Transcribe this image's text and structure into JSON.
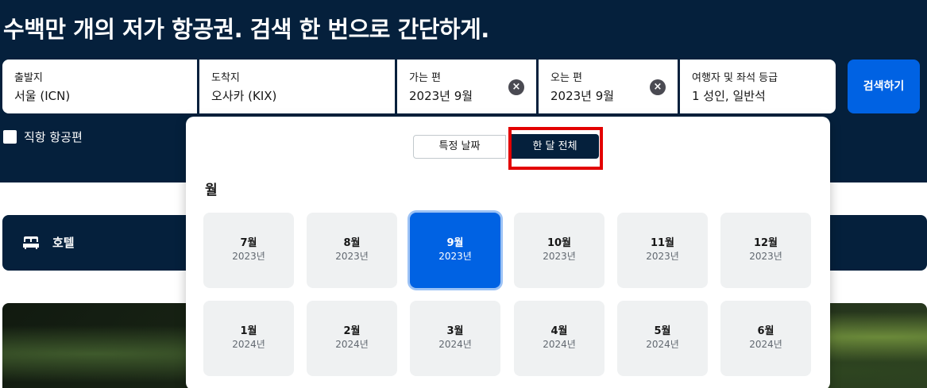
{
  "headline": "수백만 개의 저가 항공권. 검색 한 번으로 간단하게.",
  "search": {
    "origin": {
      "label": "출발지",
      "value": "서울 (ICN)"
    },
    "destination": {
      "label": "도착지",
      "value": "오사카 (KIX)"
    },
    "depart": {
      "label": "가는 편",
      "value": "2023년 9월"
    },
    "return": {
      "label": "오는 편",
      "value": "2023년 9월"
    },
    "travelers": {
      "label": "여행자 및 좌석 등급",
      "value": "1 성인, 일반석"
    },
    "clear_icon": "×",
    "search_button": "검색하기",
    "direct_only": "직항 항공편"
  },
  "hotel": {
    "label": "호텔",
    "icon": "bed-icon"
  },
  "picker": {
    "tab_specific": "특정 날짜",
    "tab_month": "한 달 전체",
    "active_tab": "한 달 전체",
    "heading": "월",
    "selected_month": "9월 2023년",
    "accent_color": "#0062e3",
    "highlight_color": "#e30000",
    "months": [
      {
        "month": "7월",
        "year": "2023년"
      },
      {
        "month": "8월",
        "year": "2023년"
      },
      {
        "month": "9월",
        "year": "2023년"
      },
      {
        "month": "10월",
        "year": "2023년"
      },
      {
        "month": "11월",
        "year": "2023년"
      },
      {
        "month": "12월",
        "year": "2023년"
      },
      {
        "month": "1월",
        "year": "2024년"
      },
      {
        "month": "2월",
        "year": "2024년"
      },
      {
        "month": "3월",
        "year": "2024년"
      },
      {
        "month": "4월",
        "year": "2024년"
      },
      {
        "month": "5월",
        "year": "2024년"
      },
      {
        "month": "6월",
        "year": "2024년"
      }
    ]
  }
}
